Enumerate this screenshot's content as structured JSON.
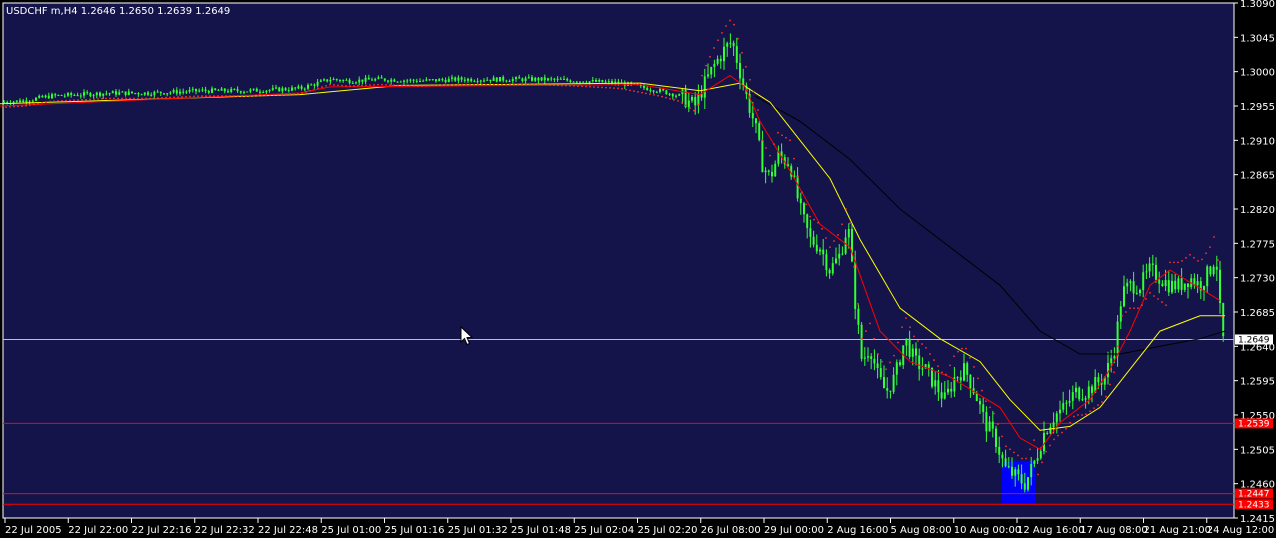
{
  "header": {
    "symbol": "USDCHF m,H4",
    "ohlc": "1.2646 1.2650 1.2639 1.2649"
  },
  "colors": {
    "background": "#000000",
    "plot_bg": "#14144a",
    "candle": "#33ff33",
    "ma_fast": "#ff0000",
    "ma_mid": "#ffff00",
    "ma_slow": "#000000",
    "sar": "#ff3030",
    "bid_line": "#c0c0c0",
    "level_line": "#ff0000",
    "highlight": "#0000ff"
  },
  "chart_data": {
    "type": "candlestick",
    "y_ticks": [
      "1.3090",
      "1.3045",
      "1.3000",
      "1.2955",
      "1.2910",
      "1.2865",
      "1.2820",
      "1.2775",
      "1.2730",
      "1.2685",
      "1.2640",
      "1.2595",
      "1.2550",
      "1.2505",
      "1.2460",
      "1.2415"
    ],
    "ylim": [
      1.2415,
      1.309
    ],
    "x_ticks": [
      "22 Jul 2005",
      "22 Jul 22:00",
      "22 Jul 22:16",
      "22 Jul 22:32",
      "22 Jul 22:48",
      "25 Jul 01:00",
      "25 Jul 01:16",
      "25 Jul 01:32",
      "25 Jul 01:48",
      "25 Jul 02:04",
      "25 Jul 02:20",
      "26 Jul 08:00",
      "29 Jul 00:00",
      "2 Aug 16:00",
      "5 Aug 08:00",
      "10 Aug 00:00",
      "12 Aug 16:00",
      "17 Aug 08:00",
      "21 Aug 21:00",
      "24 Aug 12:00"
    ],
    "price_path": [
      [
        0,
        1.296
      ],
      [
        25,
        1.2962
      ],
      [
        50,
        1.2968
      ],
      [
        80,
        1.297
      ],
      [
        110,
        1.2972
      ],
      [
        150,
        1.2972
      ],
      [
        200,
        1.2975
      ],
      [
        250,
        1.2975
      ],
      [
        300,
        1.2978
      ],
      [
        330,
        1.299
      ],
      [
        350,
        1.2988
      ],
      [
        380,
        1.299
      ],
      [
        420,
        1.2988
      ],
      [
        460,
        1.299
      ],
      [
        500,
        1.299
      ],
      [
        540,
        1.299
      ],
      [
        580,
        1.2988
      ],
      [
        620,
        1.2985
      ],
      [
        660,
        1.2975
      ],
      [
        680,
        1.2968
      ],
      [
        695,
        1.2955
      ],
      [
        705,
        1.2985
      ],
      [
        715,
        1.301
      ],
      [
        725,
        1.303
      ],
      [
        732,
        1.304
      ],
      [
        740,
        1.3
      ],
      [
        748,
        1.296
      ],
      [
        755,
        1.293
      ],
      [
        762,
        1.288
      ],
      [
        770,
        1.286
      ],
      [
        778,
        1.289
      ],
      [
        790,
        1.288
      ],
      [
        800,
        1.282
      ],
      [
        810,
        1.278
      ],
      [
        820,
        1.277
      ],
      [
        830,
        1.274
      ],
      [
        840,
        1.276
      ],
      [
        848,
        1.28
      ],
      [
        855,
        1.27
      ],
      [
        862,
        1.262
      ],
      [
        870,
        1.264
      ],
      [
        878,
        1.26
      ],
      [
        886,
        1.258
      ],
      [
        895,
        1.26
      ],
      [
        905,
        1.265
      ],
      [
        915,
        1.262
      ],
      [
        925,
        1.261
      ],
      [
        935,
        1.259
      ],
      [
        945,
        1.257
      ],
      [
        955,
        1.26
      ],
      [
        965,
        1.261
      ],
      [
        975,
        1.258
      ],
      [
        985,
        1.254
      ],
      [
        995,
        1.252
      ],
      [
        1005,
        1.248
      ],
      [
        1015,
        1.247
      ],
      [
        1025,
        1.246
      ],
      [
        1035,
        1.249
      ],
      [
        1045,
        1.253
      ],
      [
        1055,
        1.255
      ],
      [
        1065,
        1.256
      ],
      [
        1075,
        1.258
      ],
      [
        1085,
        1.258
      ],
      [
        1095,
        1.259
      ],
      [
        1105,
        1.26
      ],
      [
        1115,
        1.264
      ],
      [
        1122,
        1.271
      ],
      [
        1130,
        1.272
      ],
      [
        1140,
        1.272
      ],
      [
        1150,
        1.274
      ],
      [
        1160,
        1.273
      ],
      [
        1170,
        1.272
      ],
      [
        1180,
        1.272
      ],
      [
        1190,
        1.273
      ],
      [
        1200,
        1.272
      ],
      [
        1210,
        1.274
      ],
      [
        1216,
        1.276
      ],
      [
        1222,
        1.2649
      ]
    ],
    "ma_fast_path": [
      [
        0,
        1.2955
      ],
      [
        300,
        1.2972
      ],
      [
        330,
        1.298
      ],
      [
        640,
        1.2983
      ],
      [
        700,
        1.297
      ],
      [
        730,
        1.2995
      ],
      [
        745,
        1.298
      ],
      [
        760,
        1.2935
      ],
      [
        790,
        1.287
      ],
      [
        820,
        1.28
      ],
      [
        850,
        1.277
      ],
      [
        880,
        1.266
      ],
      [
        910,
        1.262
      ],
      [
        950,
        1.26
      ],
      [
        1000,
        1.256
      ],
      [
        1020,
        1.252
      ],
      [
        1040,
        1.2505
      ],
      [
        1060,
        1.254
      ],
      [
        1090,
        1.257
      ],
      [
        1110,
        1.261
      ],
      [
        1130,
        1.266
      ],
      [
        1150,
        1.272
      ],
      [
        1170,
        1.274
      ],
      [
        1195,
        1.272
      ],
      [
        1220,
        1.27
      ]
    ],
    "ma_mid_path": [
      [
        0,
        1.2958
      ],
      [
        300,
        1.297
      ],
      [
        400,
        1.2982
      ],
      [
        640,
        1.2985
      ],
      [
        700,
        1.2975
      ],
      [
        740,
        1.2985
      ],
      [
        770,
        1.296
      ],
      [
        800,
        1.291
      ],
      [
        830,
        1.286
      ],
      [
        860,
        1.278
      ],
      [
        900,
        1.269
      ],
      [
        940,
        1.265
      ],
      [
        980,
        1.262
      ],
      [
        1010,
        1.257
      ],
      [
        1040,
        1.253
      ],
      [
        1070,
        1.2535
      ],
      [
        1100,
        1.256
      ],
      [
        1130,
        1.261
      ],
      [
        1160,
        1.266
      ],
      [
        1200,
        1.268
      ],
      [
        1225,
        1.268
      ]
    ],
    "ma_slow_path": [
      [
        755,
        1.2968
      ],
      [
        800,
        1.2935
      ],
      [
        850,
        1.2885
      ],
      [
        900,
        1.282
      ],
      [
        950,
        1.277
      ],
      [
        1000,
        1.272
      ],
      [
        1040,
        1.266
      ],
      [
        1080,
        1.263
      ],
      [
        1120,
        1.263
      ],
      [
        1160,
        1.264
      ],
      [
        1200,
        1.265
      ],
      [
        1225,
        1.266
      ]
    ],
    "bid": 1.2649,
    "levels": [
      1.2539,
      1.2447,
      1.2433
    ],
    "highlight_range": {
      "x0": 1002,
      "x1": 1036,
      "y0": 1.2433,
      "y1": 1.249
    },
    "price_tags": [
      "1.2649",
      "1.2539",
      "1.2447",
      "1.2433"
    ]
  }
}
